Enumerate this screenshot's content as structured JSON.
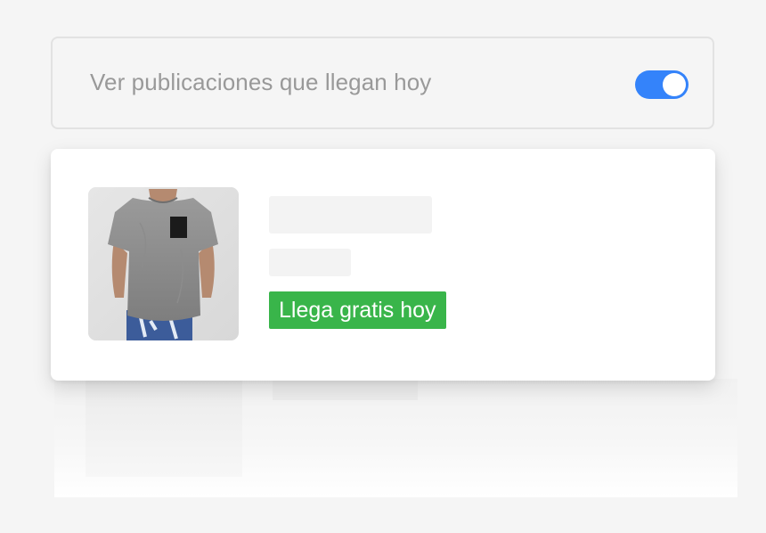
{
  "filter": {
    "label": "Ver publicaciones que llegan hoy",
    "toggle_on": true,
    "toggle_color": "#3483fa",
    "toggle_icon": "toggle-switch-icon"
  },
  "product": {
    "image_icon": "gray-t-shirt-photo",
    "shipping_badge": "Llega gratis hoy",
    "badge_color": "#39b54a"
  }
}
